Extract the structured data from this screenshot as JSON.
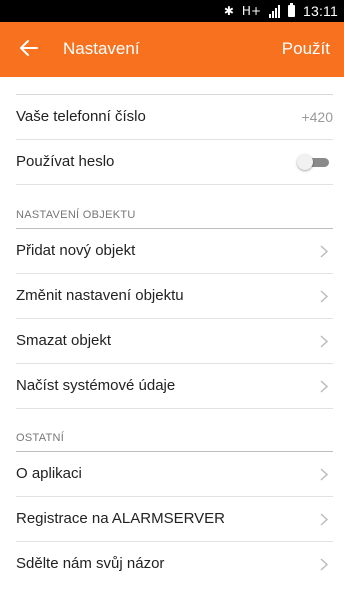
{
  "status_bar": {
    "bluetooth_icon": "bluetooth-icon",
    "network_label": "H+",
    "signal_icon": "signal-icon",
    "battery_icon": "battery-icon",
    "time": "13:11"
  },
  "app_bar": {
    "back_icon": "arrow-left-icon",
    "title": "Nastavení",
    "action": "Použít",
    "color": "#f7711f"
  },
  "settings": {
    "phone": {
      "label": "Vaše telefonní číslo",
      "value": "+420"
    },
    "password": {
      "label": "Používat heslo",
      "enabled": false
    },
    "section_object": {
      "title": "NASTAVENÍ OBJEKTU"
    },
    "object_items": [
      {
        "label": "Přidat nový objekt"
      },
      {
        "label": "Změnit nastavení objektu"
      },
      {
        "label": "Smazat objekt"
      },
      {
        "label": "Načíst systémové údaje"
      }
    ],
    "section_other": {
      "title": "OSTATNÍ"
    },
    "other_items": [
      {
        "label": "O aplikaci"
      },
      {
        "label": "Registrace na ALARMSERVER"
      },
      {
        "label": "Sdělte nám svůj názor"
      }
    ]
  }
}
